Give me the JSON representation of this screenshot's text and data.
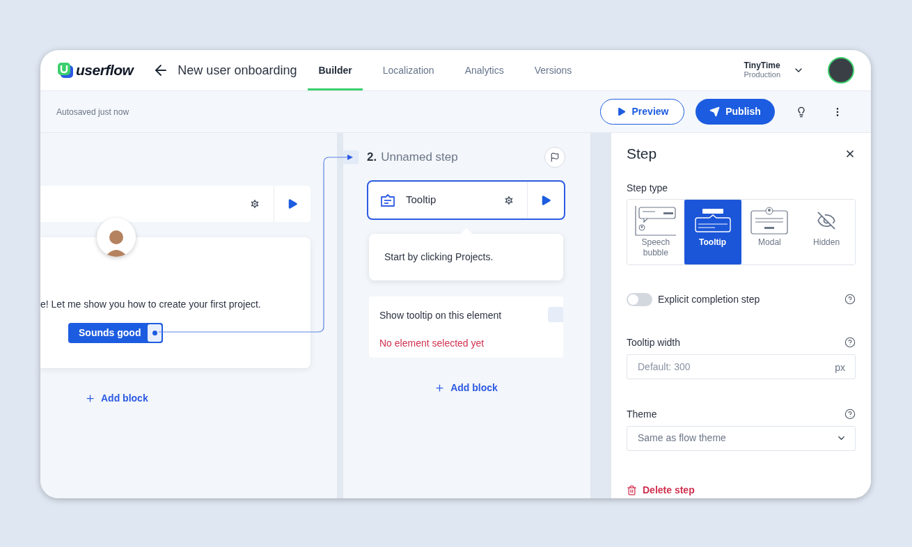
{
  "header": {
    "logo": "userflow",
    "title": "New user onboarding",
    "tabs": [
      {
        "label": "Builder",
        "selected": true
      },
      {
        "label": "Localization",
        "selected": false
      },
      {
        "label": "Analytics",
        "selected": false
      },
      {
        "label": "Versions",
        "selected": false
      }
    ],
    "account": {
      "name": "TinyTime",
      "environment": "Production"
    }
  },
  "toolbar": {
    "status": "Autosaved just now",
    "buttons": [
      {
        "kind": "outline",
        "label": "Preview"
      },
      {
        "kind": "primary",
        "label": "Publish"
      }
    ]
  },
  "step_1": {
    "message": "e! Let me show you how to create your first project.",
    "button": "Sounds good",
    "add_block": "Add block"
  },
  "step_2": {
    "number": "2.",
    "name": "Unnamed step",
    "block": "Tooltip",
    "tooltip_text": "Start by clicking Projects.",
    "target_label": "Show tooltip on this element",
    "target_error": "No element selected yet",
    "add_block": "Add block"
  },
  "panel": {
    "title": "Step",
    "step_type_label": "Step type",
    "step_types": [
      {
        "kind": "speech",
        "label": "Speech bubble",
        "selected": false
      },
      {
        "kind": "tooltip",
        "label": "Tooltip",
        "selected": true
      },
      {
        "kind": "modal",
        "label": "Modal",
        "selected": false
      },
      {
        "kind": "hidden",
        "label": "Hidden",
        "selected": false
      }
    ],
    "completion": {
      "label": "Explicit completion step",
      "on": false
    },
    "width": {
      "label": "Tooltip width",
      "placeholder": "Default: 300",
      "unit": "px"
    },
    "theme": {
      "label": "Theme",
      "value": "Same as flow theme"
    },
    "delete": "Delete step"
  }
}
